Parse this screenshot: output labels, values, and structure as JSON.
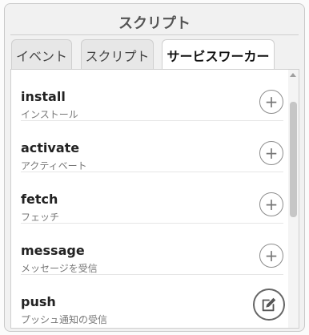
{
  "panel": {
    "title": "スクリプト"
  },
  "tabs": [
    {
      "label": "イベント",
      "active": false
    },
    {
      "label": "スクリプト",
      "active": false
    },
    {
      "label": "サービスワーカー",
      "active": true
    }
  ],
  "events": [
    {
      "name": "install",
      "description": "インストール"
    },
    {
      "name": "activate",
      "description": "アクティベート"
    },
    {
      "name": "fetch",
      "description": "フェッチ"
    },
    {
      "name": "message",
      "description": "メッセージを受信"
    },
    {
      "name": "push",
      "description": "プッシュ通知の受信"
    }
  ],
  "icons": {
    "add": "plus-circle-icon",
    "edit": "edit-pencil-icon"
  },
  "colors": {
    "active_tab_underline": "#4a90d9"
  }
}
